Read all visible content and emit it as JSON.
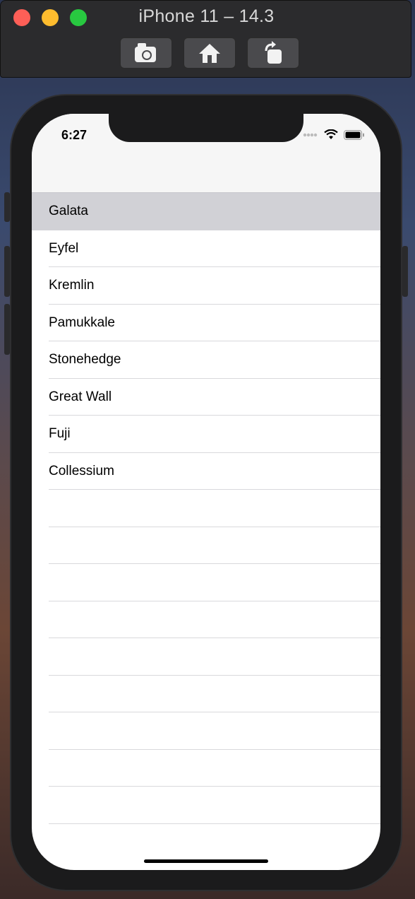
{
  "window": {
    "title": "iPhone 11 – 14.3",
    "toolbar": [
      {
        "icon": "screenshot-icon"
      },
      {
        "icon": "home-icon"
      },
      {
        "icon": "rotate-icon"
      }
    ]
  },
  "status_bar": {
    "time": "6:27",
    "icons": [
      "signal-icon",
      "wifi-icon",
      "battery-icon"
    ]
  },
  "table": {
    "rows": [
      "Galata",
      "Eyfel",
      "Kremlin",
      "Pamukkale",
      "Stonehedge",
      "Great Wall",
      "Fuji",
      "Collessium"
    ],
    "selected_index": 0,
    "empty_rows": 9
  },
  "colors": {
    "selected_row": "#d1d1d6",
    "separator": "#d9d9dc"
  }
}
